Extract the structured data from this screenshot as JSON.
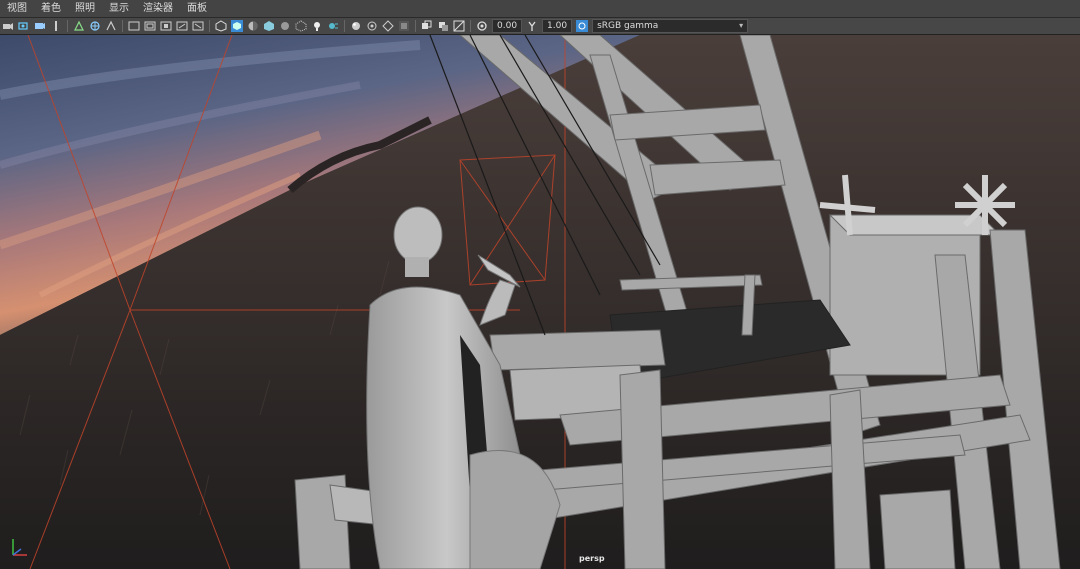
{
  "menu": {
    "items": [
      "视图",
      "着色",
      "照明",
      "显示",
      "渲染器",
      "面板"
    ]
  },
  "toolbar": {
    "exposure_value": "0.00",
    "gamma_value": "1.00",
    "color_space": "sRGB gamma",
    "icons": [
      "camera-select-icon",
      "camera-attr-icon",
      "bookmark-icon",
      "image-plane-icon",
      "grid-icon",
      "film-gate-icon",
      "resolution-gate-icon",
      "gate-mask-icon",
      "field-chart-icon",
      "safe-action-icon",
      "safe-title-icon",
      "wireframe-icon",
      "smooth-shade-icon",
      "shade-selected-icon",
      "textured-icon",
      "lighting-icon",
      "shadows-icon",
      "screen-space-ao-icon",
      "motion-blur-icon",
      "anti-alias-icon",
      "depth-of-field-icon",
      "isolate-select-icon",
      "xray-icon",
      "xray-joints-icon",
      "exposure-icon",
      "gamma-icon",
      "color-management-icon"
    ]
  },
  "viewport": {
    "camera_label": "persp",
    "accent_color": "#c0442a",
    "gizmo": {
      "x_color": "#d64040",
      "y_color": "#40c040",
      "z_color": "#4070d6"
    }
  }
}
